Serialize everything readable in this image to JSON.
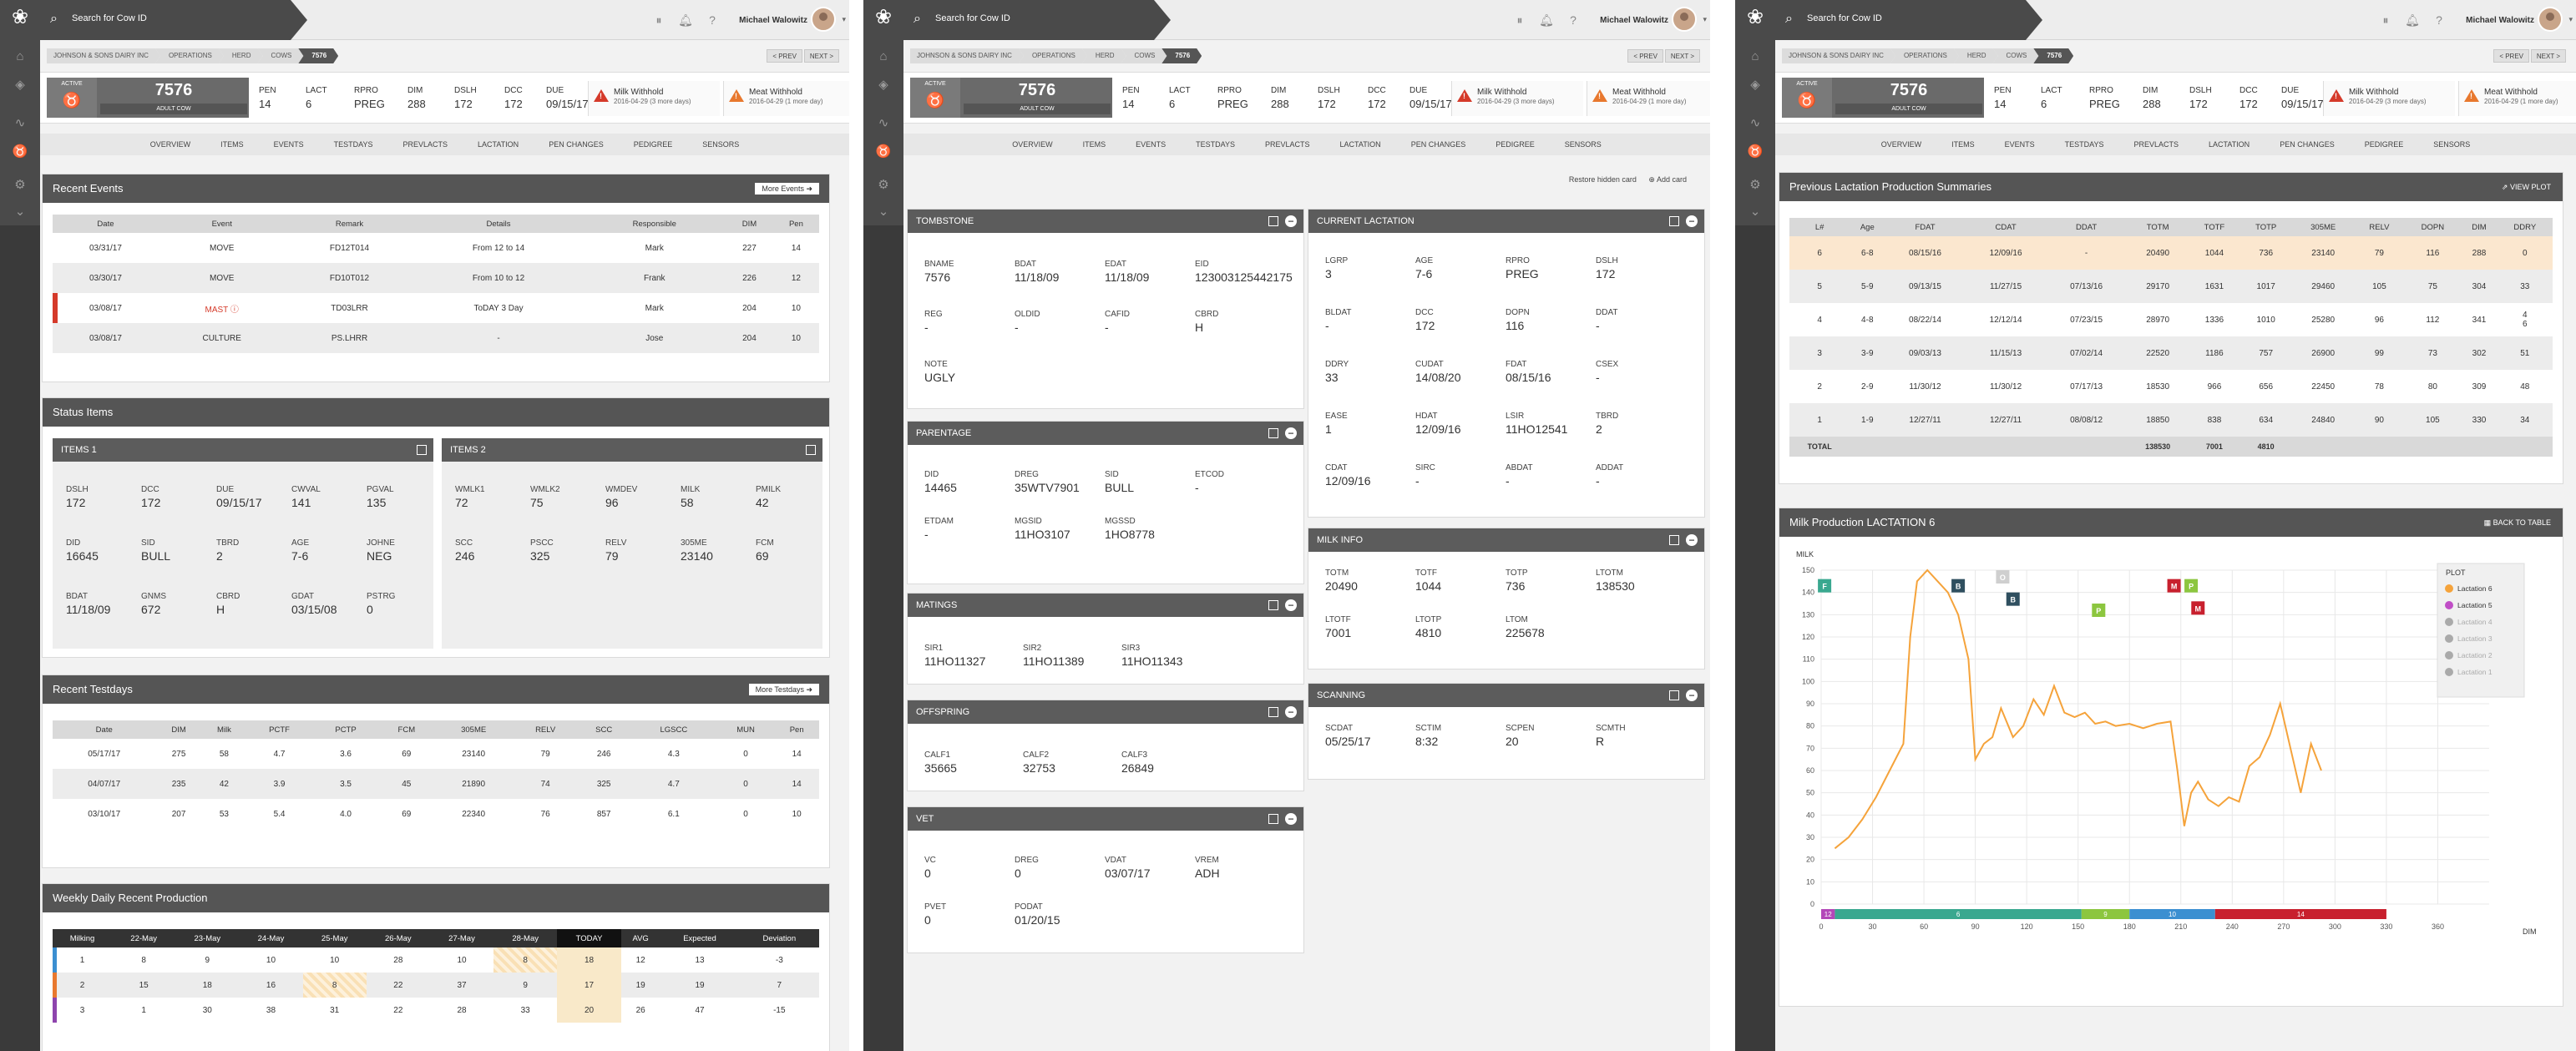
{
  "app": {
    "search_placeholder": "Search for Cow ID",
    "user_name": "Michael Walowitz",
    "breadcrumbs": [
      "JOHNSON & SONS DAIRY INC",
      "OPERATIONS",
      "HERD",
      "COWS",
      "7576"
    ],
    "prev_label": "< PREV",
    "next_label": "NEXT >"
  },
  "cow": {
    "status": "ACTIVE",
    "id": "7576",
    "type": "ADULT COW",
    "stats": [
      {
        "k": "PEN",
        "v": "14"
      },
      {
        "k": "LACT",
        "v": "6"
      },
      {
        "k": "RPRO",
        "v": "PREG"
      },
      {
        "k": "DIM",
        "v": "288"
      },
      {
        "k": "DSLH",
        "v": "172"
      },
      {
        "k": "DCC",
        "v": "172"
      },
      {
        "k": "DUE",
        "v": "09/15/17"
      }
    ],
    "milk_withhold": {
      "title": "Milk Withhold",
      "sub": "2016-04-29 (3 more days)"
    },
    "meat_withhold": {
      "title": "Meat Withhold",
      "sub": "2016-04-29 (1 more day)"
    }
  },
  "tabs": [
    "OVERVIEW",
    "ITEMS",
    "EVENTS",
    "TESTDAYS",
    "PREVLACTS",
    "LACTATION",
    "PEN CHANGES",
    "PEDIGREE",
    "SENSORS"
  ],
  "recent_events": {
    "title": "Recent Events",
    "more": "More Events",
    "headers": [
      "Date",
      "Event",
      "Remark",
      "Details",
      "Responsible",
      "DIM",
      "Pen"
    ],
    "rows": [
      [
        "03/31/17",
        "MOVE",
        "FD12T014",
        "From 12 to 14",
        "Mark",
        "227",
        "14"
      ],
      [
        "03/30/17",
        "MOVE",
        "FD10T012",
        "From 10 to 12",
        "Frank",
        "226",
        "12"
      ],
      [
        "03/08/17",
        "MAST",
        "TD03LRR",
        "ToDAY 3 Day",
        "Mark",
        "204",
        "10"
      ],
      [
        "03/08/17",
        "CULTURE",
        "PS.LHRR",
        "-",
        "Jose",
        "204",
        "10"
      ]
    ]
  },
  "status_items": {
    "title": "Status Items",
    "items1": {
      "title": "ITEMS 1",
      "fields": [
        {
          "k": "DSLH",
          "v": "172"
        },
        {
          "k": "DCC",
          "v": "172"
        },
        {
          "k": "DUE",
          "v": "09/15/17"
        },
        {
          "k": "CWVAL",
          "v": "141"
        },
        {
          "k": "PGVAL",
          "v": "135"
        },
        {
          "k": "DID",
          "v": "16645"
        },
        {
          "k": "SID",
          "v": "BULL"
        },
        {
          "k": "TBRD",
          "v": "2"
        },
        {
          "k": "AGE",
          "v": "7-6"
        },
        {
          "k": "JOHNE",
          "v": "NEG"
        },
        {
          "k": "BDAT",
          "v": "11/18/09"
        },
        {
          "k": "GNMS",
          "v": "672"
        },
        {
          "k": "CBRD",
          "v": "H"
        },
        {
          "k": "GDAT",
          "v": "03/15/08"
        },
        {
          "k": "PSTRG",
          "v": "0"
        }
      ]
    },
    "items2": {
      "title": "ITEMS 2",
      "fields": [
        {
          "k": "WMLK1",
          "v": "72"
        },
        {
          "k": "WMLK2",
          "v": "75"
        },
        {
          "k": "WMDEV",
          "v": "96"
        },
        {
          "k": "MILK",
          "v": "58"
        },
        {
          "k": "PMILK",
          "v": "42"
        },
        {
          "k": "SCC",
          "v": "246"
        },
        {
          "k": "PSCC",
          "v": "325"
        },
        {
          "k": "RELV",
          "v": "79"
        },
        {
          "k": "305ME",
          "v": "23140"
        },
        {
          "k": "FCM",
          "v": "69"
        }
      ]
    }
  },
  "recent_testdays": {
    "title": "Recent Testdays",
    "more": "More Testdays",
    "headers": [
      "Date",
      "DIM",
      "Milk",
      "PCTF",
      "PCTP",
      "FCM",
      "305ME",
      "RELV",
      "SCC",
      "LGSCC",
      "MUN",
      "Pen"
    ],
    "rows": [
      [
        "05/17/17",
        "275",
        "58",
        "4.7",
        "3.6",
        "69",
        "23140",
        "79",
        "246",
        "4.3",
        "0",
        "14"
      ],
      [
        "04/07/17",
        "235",
        "42",
        "3.9",
        "3.5",
        "45",
        "21890",
        "74",
        "325",
        "4.7",
        "0",
        "14"
      ],
      [
        "03/10/17",
        "207",
        "53",
        "5.4",
        "4.0",
        "69",
        "22340",
        "76",
        "857",
        "6.1",
        "0",
        "10"
      ]
    ]
  },
  "weekly": {
    "title": "Weekly Daily Recent Production",
    "headers": [
      "Milking",
      "22-May",
      "23-May",
      "24-May",
      "25-May",
      "26-May",
      "27-May",
      "28-May",
      "TODAY",
      "AVG",
      "Expected",
      "Deviation"
    ],
    "rows": [
      [
        "1",
        "8",
        "9",
        "10",
        "10",
        "28",
        "10",
        "8",
        "18",
        "12",
        "13",
        "-3"
      ],
      [
        "2",
        "15",
        "18",
        "16",
        "8",
        "22",
        "37",
        "9",
        "17",
        "19",
        "19",
        "7"
      ],
      [
        "3",
        "1",
        "30",
        "38",
        "31",
        "22",
        "28",
        "33",
        "20",
        "26",
        "47",
        "-15"
      ]
    ],
    "row_colors": [
      "#3b8fd1",
      "#e8782e",
      "#8e44ad"
    ]
  },
  "restore_label": "Restore hidden card",
  "add_card_label": "Add card",
  "tombstone": {
    "title": "TOMBSTONE",
    "fields": [
      {
        "k": "BNAME",
        "v": "7576"
      },
      {
        "k": "BDAT",
        "v": "11/18/09"
      },
      {
        "k": "EDAT",
        "v": "11/18/09"
      },
      {
        "k": "EID",
        "v": "123003125442175"
      },
      {
        "k": "REG",
        "v": "-"
      },
      {
        "k": "OLDID",
        "v": "-"
      },
      {
        "k": "CAFID",
        "v": "-"
      },
      {
        "k": "CBRD",
        "v": "H"
      },
      {
        "k": "NOTE",
        "v": "UGLY"
      }
    ]
  },
  "parentage": {
    "title": "PARENTAGE",
    "fields": [
      {
        "k": "DID",
        "v": "14465"
      },
      {
        "k": "DREG",
        "v": "35WTV7901"
      },
      {
        "k": "SID",
        "v": "BULL"
      },
      {
        "k": "ETCOD",
        "v": "-"
      },
      {
        "k": "ETDAM",
        "v": "-"
      },
      {
        "k": "MGSID",
        "v": "11HO3107"
      },
      {
        "k": "MGSSD",
        "v": "1HO8778"
      }
    ]
  },
  "matings": {
    "title": "MATINGS",
    "fields": [
      {
        "k": "SIR1",
        "v": "11HO11327"
      },
      {
        "k": "SIR2",
        "v": "11HO11389"
      },
      {
        "k": "SIR3",
        "v": "11HO11343"
      }
    ]
  },
  "offspring": {
    "title": "OFFSPRING",
    "fields": [
      {
        "k": "CALF1",
        "v": "35665"
      },
      {
        "k": "CALF2",
        "v": "32753"
      },
      {
        "k": "CALF3",
        "v": "26849"
      }
    ]
  },
  "vet": {
    "title": "VET",
    "fields": [
      {
        "k": "VC",
        "v": "0"
      },
      {
        "k": "DREG",
        "v": "0"
      },
      {
        "k": "VDAT",
        "v": "03/07/17"
      },
      {
        "k": "VREM",
        "v": "ADH"
      },
      {
        "k": "PVET",
        "v": "0"
      },
      {
        "k": "PODAT",
        "v": "01/20/15"
      }
    ]
  },
  "current_lactation": {
    "title": "CURRENT LACTATION",
    "fields": [
      {
        "k": "LGRP",
        "v": "3"
      },
      {
        "k": "AGE",
        "v": "7-6"
      },
      {
        "k": "RPRO",
        "v": "PREG"
      },
      {
        "k": "DSLH",
        "v": "172"
      },
      {
        "k": "BLDAT",
        "v": "-"
      },
      {
        "k": "DCC",
        "v": "172"
      },
      {
        "k": "DOPN",
        "v": "116"
      },
      {
        "k": "DDAT",
        "v": "-"
      },
      {
        "k": "DDRY",
        "v": "33"
      },
      {
        "k": "CUDAT",
        "v": "14/08/20"
      },
      {
        "k": "FDAT",
        "v": "08/15/16"
      },
      {
        "k": "CSEX",
        "v": "-"
      },
      {
        "k": "EASE",
        "v": "1"
      },
      {
        "k": "HDAT",
        "v": "12/09/16"
      },
      {
        "k": "LSIR",
        "v": "11HO12541"
      },
      {
        "k": "TBRD",
        "v": "2"
      },
      {
        "k": "CDAT",
        "v": "12/09/16"
      },
      {
        "k": "SIRC",
        "v": "-"
      },
      {
        "k": "ABDAT",
        "v": "-"
      },
      {
        "k": "ADDAT",
        "v": "-"
      }
    ]
  },
  "milk_info": {
    "title": "MILK INFO",
    "fields": [
      {
        "k": "TOTM",
        "v": "20490"
      },
      {
        "k": "TOTF",
        "v": "1044"
      },
      {
        "k": "TOTP",
        "v": "736"
      },
      {
        "k": "LTOTM",
        "v": "138530"
      },
      {
        "k": "LTOTF",
        "v": "7001"
      },
      {
        "k": "LTOTP",
        "v": "4810"
      },
      {
        "k": "LTOM",
        "v": "225678"
      }
    ]
  },
  "scanning": {
    "title": "SCANNING",
    "fields": [
      {
        "k": "SCDAT",
        "v": "05/25/17"
      },
      {
        "k": "SCTIM",
        "v": "8:32"
      },
      {
        "k": "SCPEN",
        "v": "20"
      },
      {
        "k": "SCMTH",
        "v": "R"
      }
    ]
  },
  "prev_lact": {
    "title": "Previous Lactation Production Summaries",
    "view_plot": "VIEW PLOT",
    "headers": [
      "L#",
      "Age",
      "FDAT",
      "CDAT",
      "DDAT",
      "TOTM",
      "TOTF",
      "TOTP",
      "305ME",
      "RELV",
      "DOPN",
      "DIM",
      "DDRY"
    ],
    "rows": [
      [
        "6",
        "6-8",
        "08/15/16",
        "12/09/16",
        "-",
        "20490",
        "1044",
        "736",
        "23140",
        "79",
        "116",
        "288",
        "0"
      ],
      [
        "5",
        "5-9",
        "09/13/15",
        "11/27/15",
        "07/13/16",
        "29170",
        "1631",
        "1017",
        "29460",
        "105",
        "75",
        "304",
        "33"
      ],
      [
        "4",
        "4-8",
        "08/22/14",
        "12/12/14",
        "07/23/15",
        "28970",
        "1336",
        "1010",
        "25280",
        "96",
        "112",
        "341",
        "4\n6"
      ],
      [
        "3",
        "3-9",
        "09/03/13",
        "11/15/13",
        "07/02/14",
        "22520",
        "1186",
        "757",
        "26900",
        "99",
        "73",
        "302",
        "51"
      ],
      [
        "2",
        "2-9",
        "11/30/12",
        "11/30/12",
        "07/17/13",
        "18530",
        "966",
        "656",
        "22450",
        "78",
        "80",
        "309",
        "48"
      ],
      [
        "1",
        "1-9",
        "12/27/11",
        "12/27/11",
        "08/08/12",
        "18850",
        "838",
        "634",
        "24840",
        "90",
        "105",
        "330",
        "34"
      ]
    ],
    "total": [
      "TOTAL",
      "",
      "",
      "",
      "",
      "138530",
      "7001",
      "4810",
      "",
      "",
      "",
      "",
      ""
    ]
  },
  "milk_chart": {
    "title": "Milk Production LACTATION 6",
    "back_label": "BACK TO TABLE",
    "ylabel": "MILK",
    "xlabel": "DIM",
    "plot_label": "PLOT",
    "legend": [
      "Lactation 6",
      "Lactation 5",
      "Lactation 4",
      "Lactation 3",
      "Lactation 2",
      "Lactation 1"
    ],
    "bands": [
      {
        "label": "12",
        "from": 0,
        "to": 8,
        "color": "#b347b8"
      },
      {
        "label": "6",
        "from": 8,
        "to": 152,
        "color": "#39a88f"
      },
      {
        "label": "9",
        "from": 152,
        "to": 180,
        "color": "#8cc63f"
      },
      {
        "label": "10",
        "from": 180,
        "to": 230,
        "color": "#3b8fd1"
      },
      {
        "label": "14",
        "from": 230,
        "to": 330,
        "color": "#c8202e"
      }
    ],
    "markers": [
      {
        "label": "F",
        "x": 2,
        "y": 143,
        "color": "#39a88f"
      },
      {
        "label": "B",
        "x": 80,
        "y": 143,
        "color": "#2f4f5f"
      },
      {
        "label": "B",
        "x": 112,
        "y": 137,
        "color": "#2f4f5f"
      },
      {
        "label": "O",
        "x": 106,
        "y": 147,
        "color": "#cfcfcf"
      },
      {
        "label": "P",
        "x": 162,
        "y": 132,
        "color": "#8cc63f"
      },
      {
        "label": "M",
        "x": 206,
        "y": 143,
        "color": "#c8202e"
      },
      {
        "label": "P",
        "x": 216,
        "y": 143,
        "color": "#8cc63f"
      },
      {
        "label": "M",
        "x": 220,
        "y": 133,
        "color": "#c8202e"
      }
    ]
  },
  "chart_data": {
    "type": "line",
    "title": "Milk Production LACTATION 6",
    "xlabel": "DIM",
    "ylabel": "MILK",
    "xlim": [
      0,
      390
    ],
    "ylim": [
      0,
      150
    ],
    "xticks": [
      0,
      30,
      60,
      90,
      120,
      150,
      180,
      210,
      240,
      270,
      300,
      330,
      360
    ],
    "yticks": [
      0,
      10,
      20,
      30,
      40,
      50,
      60,
      70,
      80,
      90,
      100,
      110,
      120,
      130,
      140,
      150
    ],
    "grid": true,
    "legend_position": "top-right",
    "series": [
      {
        "name": "Lactation 6",
        "color": "#f5a33b",
        "x": [
          8,
          16,
          24,
          32,
          40,
          48,
          52,
          56,
          62,
          68,
          74,
          80,
          86,
          90,
          95,
          100,
          105,
          112,
          118,
          124,
          130,
          136,
          142,
          148,
          154,
          160,
          166,
          172,
          180,
          188,
          196,
          204,
          208,
          212,
          216,
          220,
          226,
          232,
          238,
          244,
          250,
          256,
          262,
          268,
          274,
          280,
          286,
          292
        ],
        "y": [
          25,
          30,
          38,
          48,
          60,
          72,
          120,
          145,
          150,
          145,
          140,
          130,
          110,
          65,
          72,
          75,
          88,
          75,
          80,
          92,
          85,
          98,
          86,
          84,
          86,
          81,
          82,
          80,
          81,
          79,
          81,
          82,
          60,
          35,
          50,
          55,
          47,
          44,
          48,
          46,
          62,
          66,
          76,
          90,
          70,
          50,
          72,
          60
        ]
      }
    ]
  }
}
